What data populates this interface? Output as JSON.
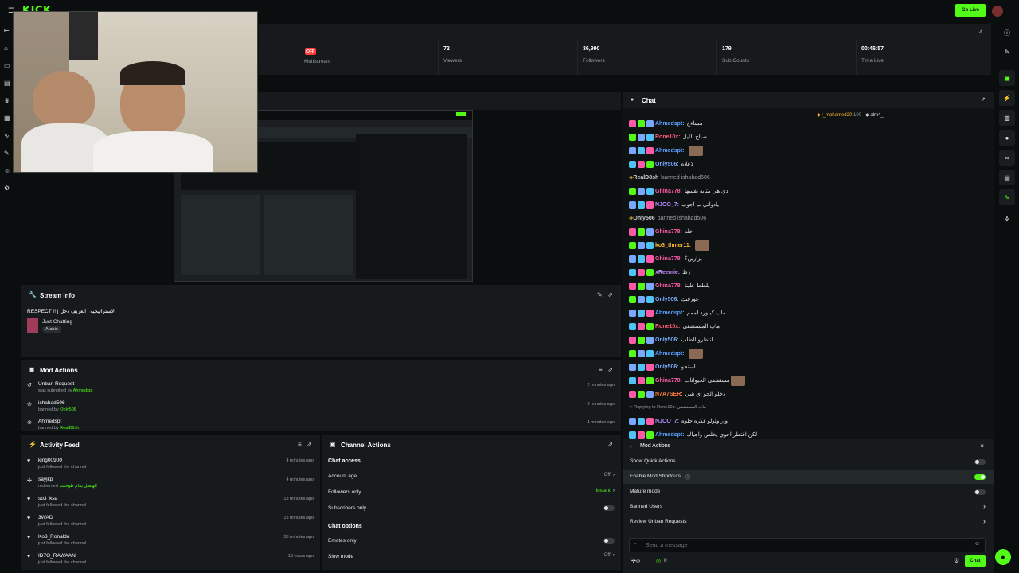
{
  "topbar": {
    "logo": "KICK",
    "go_live": "Go Live"
  },
  "stats": [
    {
      "value": "OFF",
      "label": "Multistream",
      "badge": true
    },
    {
      "value": "72",
      "label": "Viewers"
    },
    {
      "value": "36,990",
      "label": "Followers"
    },
    {
      "value": "179",
      "label": "Sub Counts"
    },
    {
      "value": "00:46:57",
      "label": "Time Live"
    }
  ],
  "stream_info": {
    "title": "Stream info",
    "stream_title": "RESPECT !! | الاستراتيجية | العريف دخل",
    "category": "Just Chatting",
    "tag": "Arabic"
  },
  "mod_actions": {
    "title": "Mod Actions",
    "rows": [
      {
        "title": "Unban Request",
        "sub_prefix": "was submitted by",
        "actor": "Ahmedspt",
        "time": "2 minutes ago"
      },
      {
        "title": "ishahad506",
        "sub_prefix": "banned by",
        "actor": "Only506",
        "time": "3 minutes ago"
      },
      {
        "title": "Ahmedspt",
        "sub_prefix": "banned by",
        "actor": "RealD8sh",
        "time": "4 minutes ago"
      }
    ]
  },
  "activity_feed": {
    "title": "Activity Feed",
    "rows": [
      {
        "name": "king00900",
        "sub": "just followed the channel",
        "time": "4 minutes ago"
      },
      {
        "name": "sayjkp",
        "sub": "redeemed",
        "reward": "الهيصل بمام طوحمتد",
        "time": "4 minutes ago"
      },
      {
        "name": "sb3_ksa",
        "sub": "just followed the channel",
        "time": "13 minutes ago"
      },
      {
        "name": "3WAD",
        "sub": "just followed the channel",
        "time": "13 minutes ago"
      },
      {
        "name": "Ko3_Ronaldo",
        "sub": "just followed the channel",
        "time": "38 minutes ago"
      },
      {
        "name": "ID7O_RAWAAN",
        "sub": "just followed the channel",
        "time": "13 hours ago"
      }
    ]
  },
  "channel_actions": {
    "title": "Channel Actions",
    "chat_access": "Chat access",
    "account_age": {
      "label": "Account age",
      "value": "Off"
    },
    "followers_only": {
      "label": "Followers only",
      "value": "Instant"
    },
    "subscribers_only": {
      "label": "Subscribers only"
    },
    "chat_options": "Chat options",
    "emotes_only": {
      "label": "Emotes only"
    },
    "slow_mode": {
      "label": "Slow mode",
      "value": "Off"
    }
  },
  "chat": {
    "title": "Chat",
    "top_gifters": [
      {
        "name": "l_mohamed20",
        "count": "100"
      },
      {
        "name": "alm4_l",
        "count": ""
      }
    ],
    "messages": [
      {
        "user": "Ahmedspt",
        "color": "#5aa0ff",
        "text": "مساءخ"
      },
      {
        "user": "Rone10x",
        "color": "#ff5a7a",
        "text": "صباح الليل"
      },
      {
        "user": "Ahmedspt",
        "color": "#5aa0ff",
        "text": "",
        "emote": true
      },
      {
        "user": "Only506",
        "color": "#7aa8ff",
        "text": "لاعلاه"
      },
      {
        "system": true,
        "user": "RealD8sh",
        "text": "banned ishahad506"
      },
      {
        "user": "Ghina778",
        "color": "#ff5aa8",
        "text": "دي هي متابه نفسها"
      },
      {
        "user": "NJOO_7",
        "color": "#b58cff",
        "text": "يادواني ب اجوب"
      },
      {
        "system": true,
        "user": "Only506",
        "text": "banned ishahad506"
      },
      {
        "user": "Ghina778",
        "color": "#ff5aa8",
        "text": "خله"
      },
      {
        "user": "ko3_thmer11",
        "color": "#ffb830",
        "text": "",
        "emote": true
      },
      {
        "user": "Ghina778",
        "color": "#ff5aa8",
        "text": "بزازين؟"
      },
      {
        "user": "xReemie",
        "color": "#c58cff",
        "text": "زط"
      },
      {
        "user": "Ghina778",
        "color": "#ff5aa8",
        "text": "يلطط علينا"
      },
      {
        "user": "Only506",
        "color": "#7aa8ff",
        "text": "عورفتك"
      },
      {
        "user": "Ahmedspt",
        "color": "#5aa0ff",
        "text": "ماب كيبورد لممم"
      },
      {
        "user": "Rone10x",
        "color": "#ff5a7a",
        "text": "ماب المستشفى"
      },
      {
        "user": "Only506",
        "color": "#7aa8ff",
        "text": "انتظرو الطلب"
      },
      {
        "user": "Ahmedspt",
        "color": "#5aa0ff",
        "text": "",
        "emote": true
      },
      {
        "user": "Only506",
        "color": "#7aa8ff",
        "text": "استحو"
      },
      {
        "user": "Ghina778",
        "color": "#ff5aa8",
        "text": "مستشفى الحيوانات",
        "emote": true
      },
      {
        "user": "N7A7SER",
        "color": "#ff7a3a",
        "text": "دخلو الجو اي شي"
      },
      {
        "reply": true,
        "text": "Replying to Rone10x: ماب المستشفى"
      },
      {
        "user": "NJOO_7",
        "color": "#b58cff",
        "text": "واراولولو فكره حلوه"
      },
      {
        "user": "Ahmedspt",
        "color": "#5aa0ff",
        "text": "لكن اقتطر اخوي يخلص واجياك"
      }
    ],
    "mod_panel": {
      "title": "Mod Actions",
      "show_quick_actions": "Show Quick Actions",
      "enable_mod_shortcuts": "Enable Mod Shortcuts",
      "mature_mode": "Mature mode",
      "banned_users": "Banned Users",
      "review_unban": "Review Unban Requests"
    },
    "send_placeholder": "Send a message",
    "points": "0",
    "chat_button": "Chat"
  },
  "colors": {
    "accent": "#53fc18",
    "panel": "#161a1c",
    "bg": "#0b0e0f"
  }
}
